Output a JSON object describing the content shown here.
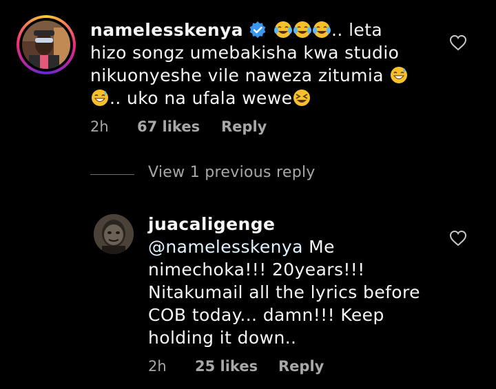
{
  "top_comment": {
    "username": "namelesskenya",
    "verified": true,
    "body_part1": ".. leta hizo songz umebakisha kwa studio nikuonyeshe vile naweza zitumia",
    "body_part2": ".. uko na ufala wewe",
    "emojis_lead": [
      "tears-of-joy",
      "tears-of-joy",
      "tears-of-joy"
    ],
    "time": "2h",
    "likes": "67 likes",
    "reply_label": "Reply"
  },
  "view_replies": {
    "label": "View 1 previous reply"
  },
  "reply_comment": {
    "username": "juacaligenge",
    "mention": "@namelesskenya",
    "body": " Me nimechoka!!! 20years!!! Nitakumail all the lyrics before COB today... damn!!! Keep holding it down..",
    "time": "2h",
    "likes": "25 likes",
    "reply_label": "Reply"
  },
  "colors": {
    "background": "#000000",
    "text": "#f5f5f5",
    "secondary": "#a8a8a8",
    "verified": "#3897f0"
  }
}
